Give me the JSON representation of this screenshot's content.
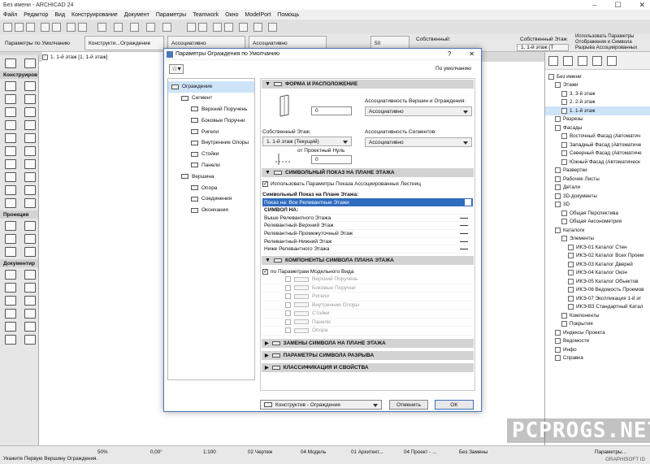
{
  "window": {
    "title": "Без имени - ARCHICAD 24"
  },
  "menu": [
    "Файл",
    "Редактор",
    "Вид",
    "Конструирование",
    "Документ",
    "Параметры",
    "Teamwork",
    "Окно",
    "ModelPort",
    "Помощь"
  ],
  "infobox": {
    "settings_label": "Параметры по Умолчанию",
    "layer_value": "Конструкти...Ограждение",
    "link1": "Ассоциативно",
    "link2": "Ассоциативно",
    "offset_value": "50",
    "own_story_label": "Собственный:",
    "own_floor_label": "Собственный Этаж",
    "floor_value": "1. 1-й этаж (Т",
    "assoc_text": "Использовать Параметры Отображения и Символа Разрыва Ассоциированных"
  },
  "tab": {
    "label": "1. 1-й этаж [1. 1-й этаж]"
  },
  "left_toolbox": {
    "sections": [
      "Конструиров",
      "Проекция",
      "Документир"
    ]
  },
  "navigator": {
    "items": [
      {
        "label": "Без имени",
        "level": 0
      },
      {
        "label": "Этажи",
        "level": 1
      },
      {
        "label": "3. 3-й этаж",
        "level": 2
      },
      {
        "label": "2. 2-й этаж",
        "level": 2
      },
      {
        "label": "1. 1-й этаж",
        "level": 2,
        "selected": true
      },
      {
        "label": "Разрезы",
        "level": 1
      },
      {
        "label": "Фасады",
        "level": 1
      },
      {
        "label": "Восточный Фасад (Автоматич",
        "level": 2
      },
      {
        "label": "Западный Фасад (Автоматиче",
        "level": 2
      },
      {
        "label": "Северный Фасад (Автоматиче",
        "level": 2
      },
      {
        "label": "Южный Фасад (Автоматическ",
        "level": 2
      },
      {
        "label": "Развертки",
        "level": 1
      },
      {
        "label": "Рабочие Листы",
        "level": 1
      },
      {
        "label": "Детали",
        "level": 1
      },
      {
        "label": "3D-документы",
        "level": 1
      },
      {
        "label": "3D",
        "level": 1
      },
      {
        "label": "Общая Перспектива",
        "level": 2
      },
      {
        "label": "Общая Аксонометрия",
        "level": 2
      },
      {
        "label": "Каталоги",
        "level": 1
      },
      {
        "label": "Элементы",
        "level": 2
      },
      {
        "label": "ИКЭ-01 Каталог Стен",
        "level": 3
      },
      {
        "label": "ИКЭ-02 Каталог Всех Проем",
        "level": 3
      },
      {
        "label": "ИКЭ-03 Каталог Дверей",
        "level": 3
      },
      {
        "label": "ИКЭ-04 Каталог Окон",
        "level": 3
      },
      {
        "label": "ИКЭ-05 Каталог Объектов",
        "level": 3
      },
      {
        "label": "ИКЭ-06 Ведомость Проемов",
        "level": 3
      },
      {
        "label": "ИКЭ-07 Экспликация 1-й эт",
        "level": 3
      },
      {
        "label": "ИКЭ-ВЗ Стандартный Катал",
        "level": 3
      },
      {
        "label": "Компоненты",
        "level": 2
      },
      {
        "label": "Покрытия",
        "level": 2
      },
      {
        "label": "Индексы Проекта",
        "level": 1
      },
      {
        "label": "Ведомости",
        "level": 1
      },
      {
        "label": "Инфо",
        "level": 1
      },
      {
        "label": "Справка",
        "level": 1
      }
    ],
    "parameters_button": "Параметры..."
  },
  "statusbar": {
    "zoom": "50%",
    "angle": "0,00°",
    "scale": "1:100",
    "layer_combo": "02 Чертеж",
    "model_view": "04 Модель",
    "arch": "01 Архитект...",
    "project": "04 Проект - ...",
    "overrides": "Без Замены",
    "hint": "Укажите Первую Вершину Ограждения.",
    "brand": "GRAPHISOFT ID"
  },
  "dialog": {
    "title": "Параметры Ограждения по Умолчанию",
    "help": "?",
    "close": "✕",
    "default_label": "По умолчанию",
    "tree": [
      {
        "label": "Ограждение",
        "level": 0,
        "selected": true
      },
      {
        "label": "Сегмент",
        "level": 1
      },
      {
        "label": "Верхний Поручень",
        "level": 2
      },
      {
        "label": "Боковые Поручни",
        "level": 2
      },
      {
        "label": "Ригели",
        "level": 2
      },
      {
        "label": "Внутренние Опоры",
        "level": 2
      },
      {
        "label": "Стойки",
        "level": 2
      },
      {
        "label": "Панели",
        "level": 2
      },
      {
        "label": "Вершина",
        "level": 1
      },
      {
        "label": "Опора",
        "level": 2
      },
      {
        "label": "Соединения",
        "level": 2
      },
      {
        "label": "Окончания",
        "level": 2
      }
    ],
    "form": {
      "section_title": "ФОРМА И РАСПОЛОЖЕНИЕ",
      "height_value": "0",
      "own_floor_label": "Собственный Этаж:",
      "own_floor_value": "1. 1-й этаж (Текущий)",
      "offset_label": "от Проектный Нуль",
      "offset_value": "0",
      "vertex_assoc_label": "Ассоциативность Вершин и Ограждения:",
      "vertex_assoc_value": "Ассоциативно",
      "segment_assoc_label": "Ассоциативность Сегментов:",
      "segment_assoc_value": "Ассоциативно"
    },
    "symbolic": {
      "section_title": "СИМВОЛЬНЫЙ ПОКАЗ НА ПЛАНЕ ЭТАЖА",
      "use_stairs_params": "Использовать Параметры Показа Ассоциированных Лестниц",
      "show_label": "Символьный Показ на Плане Этажа:",
      "show_value": "Показ на: Все Релевантные Этажи",
      "symbol_on": "СИМВОЛ НА:",
      "rows": [
        "Выше Релевантного Этажа",
        "Релевантный-Верхний Этаж",
        "Релевантный-Промежуточный Этаж",
        "Релевантный-Нижний Этаж",
        "Ниже Релевантного Этажа"
      ]
    },
    "components": {
      "section_title": "КОМПОНЕНТЫ СИМВОЛА ПЛАНА ЭТАЖА",
      "by_model": "по Параметрам Модельного Вида",
      "items": [
        "Верхний Поручень",
        "Боковые Поручни",
        "Ригели",
        "Внутренние Опоры",
        "Стойки",
        "Панели",
        "Опора"
      ]
    },
    "collapsed_sections": [
      "ЗАМЕНЫ СИМВОЛА НА ПЛАНЕ ЭТАЖА",
      "ПАРАМЕТРЫ СИМВОЛА РАЗРЫВА",
      "КЛАССИФИКАЦИЯ И СВОЙСТВА"
    ],
    "footer": {
      "layer_value": "Конструктив - Ограждение",
      "cancel": "Отменить",
      "ok": "OK"
    }
  },
  "watermark": "PCPROGS.NET"
}
